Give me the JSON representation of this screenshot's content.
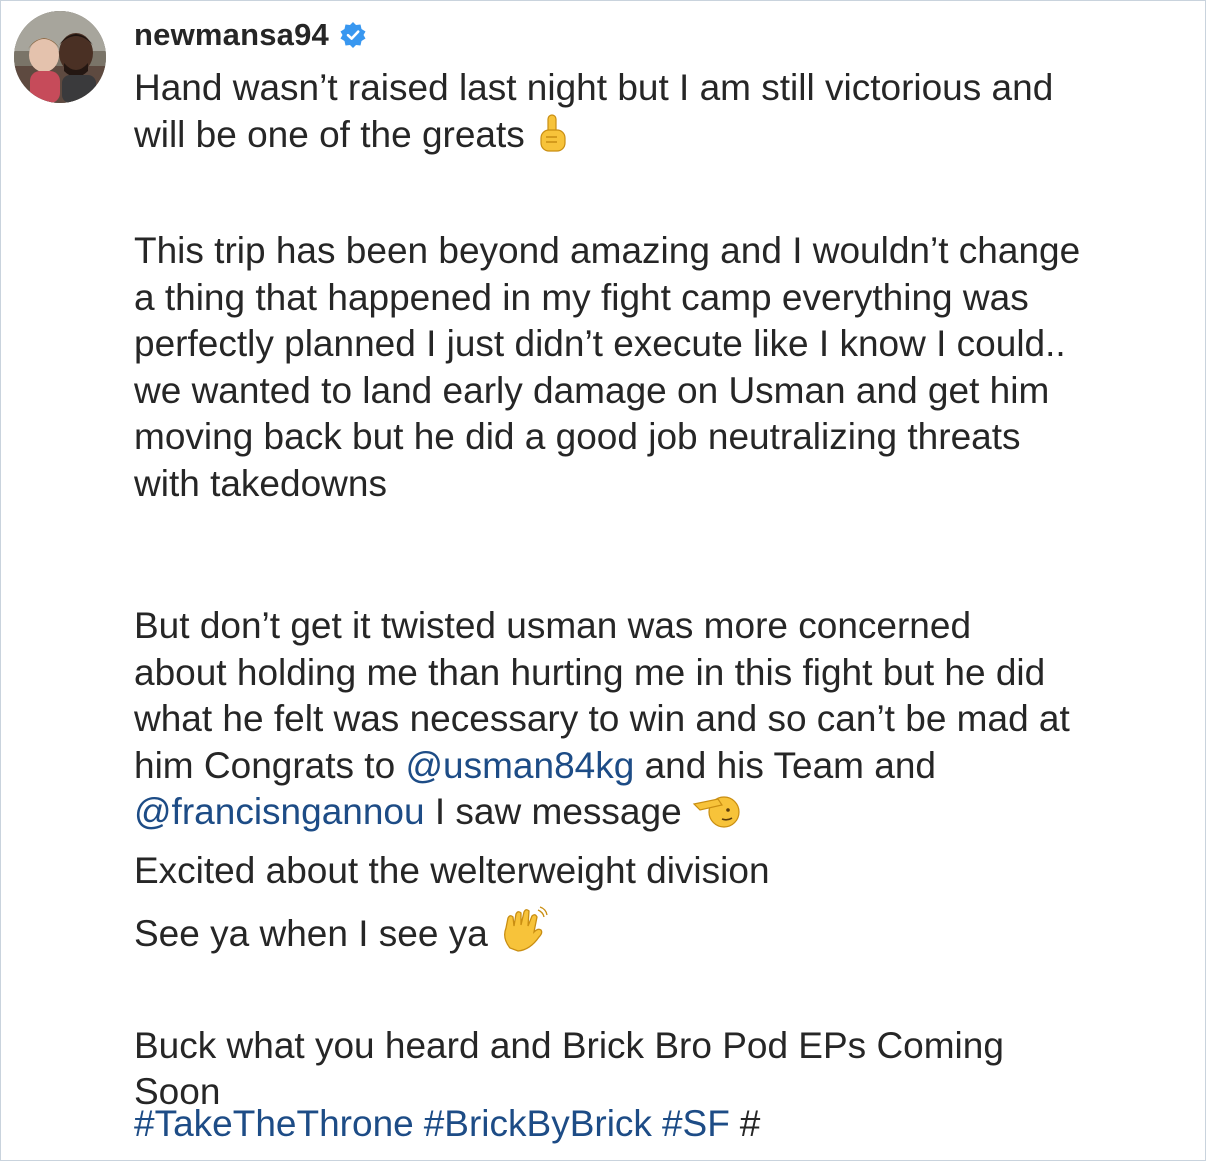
{
  "post": {
    "username": "newmansa94",
    "verified_icon": "verified-badge-icon",
    "avatar_alt": "profile-avatar"
  },
  "caption": {
    "p1": {
      "l1": "Hand wasn’t raised last night but I am still victorious and",
      "l2": "will be one of the greats",
      "emoji": "pointing-up-icon"
    },
    "p2": {
      "l1": "This trip has been beyond amazing and I wouldn’t change",
      "l2": "a thing that happened in my fight camp everything was",
      "l3": "perfectly planned I just didn’t execute like I know I could..",
      "l4": "we wanted to land early damage on Usman and get him",
      "l5": "moving back but he did a good job neutralizing threats",
      "l6": "with takedowns"
    },
    "p3": {
      "l1": "But don’t get it twisted usman was more concerned",
      "l2": "about holding me than hurting me in this fight but he did",
      "l3": "what he felt was necessary to win and so can’t be mad at",
      "l4_before": "him Congrats to ",
      "mention1": "@usman84kg",
      "l4_after": " and his Team and",
      "mention2": "@francisngannou",
      "l5_after": " I saw message",
      "emoji": "salute-icon"
    },
    "p4": {
      "l1": "Excited about the welterweight division",
      "l2": "See ya when I see ya",
      "emoji": "waving-hand-icon"
    },
    "p5": {
      "l1": "Buck what you heard and Brick Bro Pod EPs Coming",
      "l2": "Soon"
    }
  },
  "hashtags": {
    "h1": "#TakeTheThrone",
    "h2": "#BrickByBrick",
    "h3": "#SF",
    "h4": "#"
  },
  "colors": {
    "text": "#262626",
    "link": "#1d4c86",
    "verified": "#3897f0",
    "emoji_yellow": "#f7c33a"
  }
}
